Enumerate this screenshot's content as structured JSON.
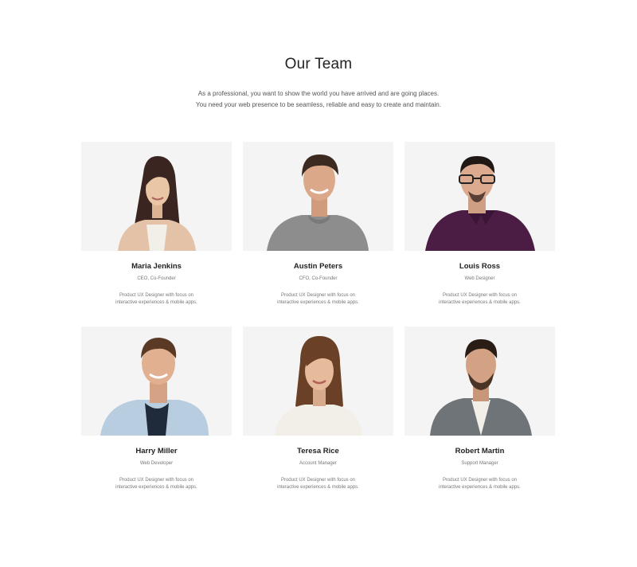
{
  "header": {
    "title": "Our Team",
    "intro_line1": "As a professional, you want to show the world you have arrived and are going places.",
    "intro_line2": "You need your web presence to be seamless, reliable and easy to create and maintain."
  },
  "team": [
    {
      "name": "Maria Jenkins",
      "role": "CEO, Co-Founder",
      "bio_line1": "Product UX Designer with focus on",
      "bio_line2": "interactive experiences & mobile apps."
    },
    {
      "name": "Austin Peters",
      "role": "CFO, Co-Founder",
      "bio_line1": "Product UX Designer with focus on",
      "bio_line2": "interactive experiences & mobile apps."
    },
    {
      "name": "Louis Ross",
      "role": "Web Designer",
      "bio_line1": "Product UX Designer with focus on",
      "bio_line2": "interactive experiences & mobile apps."
    },
    {
      "name": "Harry Miller",
      "role": "Web Developer",
      "bio_line1": "Product UX Designer with focus on",
      "bio_line2": "interactive experiences & mobile apps."
    },
    {
      "name": "Teresa Rice",
      "role": "Account Manager",
      "bio_line1": "Product UX Designer with focus on",
      "bio_line2": "interactive experiences & mobile apps."
    },
    {
      "name": "Robert Martin",
      "role": "Support Manager",
      "bio_line1": "Product UX Designer with focus on",
      "bio_line2": "interactive experiences & mobile apps."
    }
  ]
}
